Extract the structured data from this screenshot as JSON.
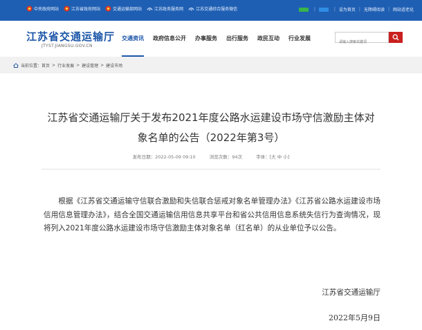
{
  "topbar": {
    "links": [
      {
        "label": "中央政府网站",
        "icon": "emblem-icon"
      },
      {
        "label": "江苏省政府网站",
        "icon": "emblem-icon"
      },
      {
        "label": "交通运输部网站",
        "icon": "emblem-icon"
      },
      {
        "label": "江苏政务服务网",
        "icon": "service-icon"
      },
      {
        "label": "江苏交通综合服务微信",
        "icon": "service-icon"
      }
    ],
    "right": {
      "set_home": "设为首页",
      "accessible": "无障碍阅读",
      "mobile": "网站适老化"
    },
    "colors": {
      "bar": "#1f5fb3",
      "emblem": "#d9361f",
      "badge_green": "#39b54a",
      "badge_blue": "#2f8de4"
    }
  },
  "header": {
    "title": "江苏省交通运输厅",
    "subtitle": "JTYST.JIANGSU.GOV.CN",
    "nav": [
      "交通资讯",
      "政府信息公开",
      "办事服务",
      "出行服务",
      "政民互动",
      "行业发展"
    ],
    "active_nav": "交通资讯",
    "search_placeholder": "请输入搜索关键词",
    "brand_color": "#1b55a8",
    "search_button_color": "#c91f1f"
  },
  "breadcrumb": {
    "prefix": "当前位置：",
    "items": [
      "首页",
      "行业发展",
      "建设管理",
      "建设市场"
    ]
  },
  "article": {
    "title_line1": "江苏省交通运输厅关于发布2021年度公路水运建设市场守信激励主体对",
    "title_line2": "象名单的公告（2022年第3号）",
    "publish_label": "发布日期：",
    "publish_date": "2022-05-09 09:10",
    "views_label": "浏览次数：",
    "views": "94次",
    "font_label": "字体：",
    "font_open": "[",
    "font_sizes": [
      "大",
      "中",
      "小"
    ],
    "font_close": "]",
    "body": "根据《江苏省交通运输守信联合激励和失信联合惩戒对象名单管理办法》《江苏省公路水运建设市场信用信息管理办法》，结合全国交通运输信用信息共享平台和省公共信用信息系统失信行为查询情况，现将列入2021年度公路水运建设市场守信激励主体对象名单（红名单）的从业单位予以公告。",
    "signature": "江苏省交通运输厅",
    "date": "2022年5月9日"
  }
}
